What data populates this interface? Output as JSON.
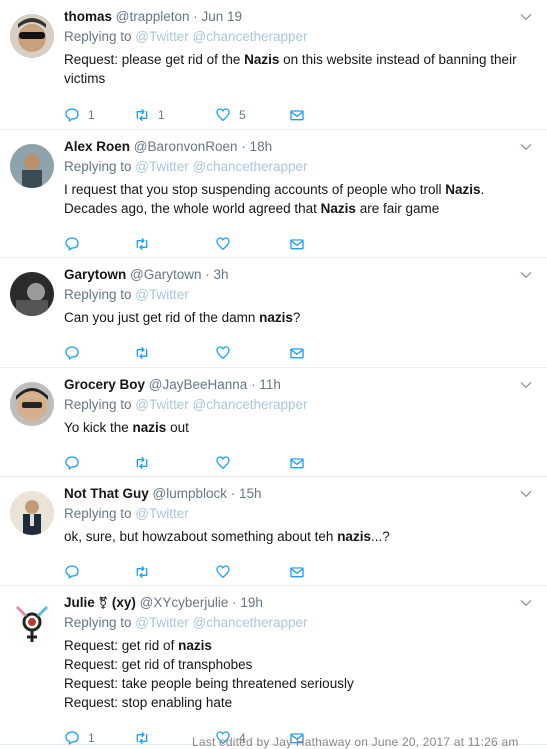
{
  "tweets": [
    {
      "name": "thomas",
      "handle": "@trappleton",
      "time": "· Jun 19",
      "replying_prefix": "Replying to",
      "replying_to": "@Twitter @chancetherapper",
      "body": [
        {
          "t": "Request: please get rid of the ",
          "b": false
        },
        {
          "t": "Nazis",
          "b": true
        },
        {
          "t": " on this website instead of banning their victims",
          "b": false
        }
      ],
      "replies": "1",
      "retweets": "1",
      "likes": "5",
      "avatar_color": "#4a4a4a"
    },
    {
      "name": "Alex Roen",
      "handle": "@BaronvonRoen",
      "time": "· 18h",
      "replying_prefix": "Replying to",
      "replying_to": "@Twitter @chancetherapper",
      "body": [
        {
          "t": "I request that you stop suspending accounts of people who troll ",
          "b": false
        },
        {
          "t": "Nazis",
          "b": true
        },
        {
          "t": ".\nDecades ago, the whole world agreed that ",
          "b": false
        },
        {
          "t": "Nazis",
          "b": true
        },
        {
          "t": " are fair game",
          "b": false
        }
      ],
      "replies": "",
      "retweets": "",
      "likes": "",
      "avatar_color": "#6c7a80"
    },
    {
      "name": "Garytown",
      "handle": "@Garytown",
      "time": "· 3h",
      "replying_prefix": "Replying to",
      "replying_to": "@Twitter",
      "body": [
        {
          "t": "Can you just get rid of the damn ",
          "b": false
        },
        {
          "t": "nazis",
          "b": true
        },
        {
          "t": "?",
          "b": false
        }
      ],
      "replies": "",
      "retweets": "",
      "likes": "",
      "avatar_color": "#3a3a3a"
    },
    {
      "name": "Grocery Boy",
      "handle": "@JayBeeHanna",
      "time": "· 11h",
      "replying_prefix": "Replying to",
      "replying_to": "@Twitter @chancetherapper",
      "body": [
        {
          "t": "Yo kick the ",
          "b": false
        },
        {
          "t": "nazis",
          "b": true
        },
        {
          "t": " out",
          "b": false
        }
      ],
      "replies": "",
      "retweets": "",
      "likes": "",
      "avatar_color": "#8a8a8a"
    },
    {
      "name": "Not That Guy",
      "handle": "@lumpblock",
      "time": "· 15h",
      "replying_prefix": "Replying to",
      "replying_to": "@Twitter",
      "body": [
        {
          "t": "ok, sure, but howzabout something about teh ",
          "b": false
        },
        {
          "t": "nazis",
          "b": true
        },
        {
          "t": "...?",
          "b": false
        }
      ],
      "replies": "",
      "retweets": "",
      "likes": "",
      "avatar_color": "#5b4a3a"
    },
    {
      "name": "Julie",
      "name_glyph": "⚧",
      "name_suffix": "(xy)",
      "handle": "@XYcyberjulie",
      "time": "· 19h",
      "replying_prefix": "Replying to",
      "replying_to": "@Twitter @chancetherapper",
      "body": [
        {
          "t": "Request: get rid of ",
          "b": false
        },
        {
          "t": "nazis",
          "b": true
        },
        {
          "t": "\nRequest: get rid of transphobes\nRequest: take people being threatened seriously\nRequest: stop enabling hate",
          "b": false
        }
      ],
      "replies": "1",
      "retweets": "",
      "likes": "4",
      "avatar_color": "#ffffff"
    }
  ],
  "footer_note": "Last edited by Jay Hathaway on June 20, 2017 at 11:26 am",
  "colors": {
    "text": "#14171a",
    "muted": "#657786",
    "link_faded": "#a9c7dd",
    "border": "#e6ecf0",
    "action": "#1da1f2"
  }
}
